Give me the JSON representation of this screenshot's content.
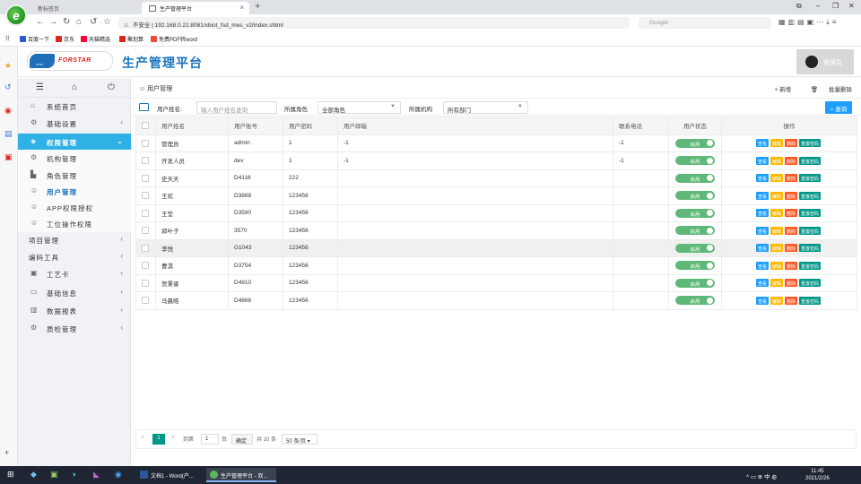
{
  "browser": {
    "tabs": [
      {
        "label": "新标签页"
      },
      {
        "label": "生产管理平台"
      }
    ],
    "url_warning": "不安全",
    "url": "192.168.0.21:8081/xbiot_fsd_mes_v2/index.shtml",
    "search_placeholder": "Google",
    "bookmarks": [
      {
        "label": "百度一下",
        "color": "#2c5bd8"
      },
      {
        "label": "京东",
        "color": "#e1251b"
      },
      {
        "label": "天猫精选",
        "color": "#ff0036"
      },
      {
        "label": "聚划算",
        "color": "#e1251b"
      },
      {
        "label": "免费PDF转word",
        "color": "#e84c3d"
      }
    ]
  },
  "header": {
    "logo_text": "FORSTAR",
    "logo_sub": "AYHC",
    "title": "生产管理平台",
    "user": "管理员"
  },
  "sidebar": {
    "items": [
      {
        "label": "系统首页",
        "icon": "⌂",
        "chev": ""
      },
      {
        "label": "基础设置",
        "icon": "⚙",
        "chev": "‹"
      },
      {
        "label": "权限管理",
        "icon": "◈",
        "chev": "⌄"
      },
      {
        "label": "机构管理",
        "icon": "⚙",
        "chev": ""
      },
      {
        "label": "角色管理",
        "icon": "▙",
        "chev": ""
      },
      {
        "label": "用户管理",
        "icon": "☺",
        "chev": ""
      },
      {
        "label": "APP权限授权",
        "icon": "☺",
        "chev": ""
      },
      {
        "label": "工位操作权限",
        "icon": "☺",
        "chev": ""
      },
      {
        "label": "项目管理",
        "icon": "",
        "chev": "‹"
      },
      {
        "label": "编码工具",
        "icon": "",
        "chev": "‹"
      },
      {
        "label": "工艺卡",
        "icon": "▣",
        "chev": "‹"
      },
      {
        "label": "基础信息",
        "icon": "▭",
        "chev": "‹"
      },
      {
        "label": "数据报表",
        "icon": "▥",
        "chev": "‹"
      },
      {
        "label": "质检管理",
        "icon": "⚙",
        "chev": "‹"
      }
    ]
  },
  "main": {
    "breadcrumb": "用户管理",
    "add_label": "+ 新增",
    "batch_delete_label": "批量删除",
    "filter": {
      "name_label": "用户姓名:",
      "name_placeholder": "输入用户姓名查询",
      "role_label": "所属角色",
      "role_value": "全部角色",
      "org_label": "所属机构",
      "org_value": "所有部门",
      "query_label": "查询"
    },
    "columns": [
      "",
      "用户姓名",
      "用户账号",
      "用户密码",
      "用户邮箱",
      "联系电话",
      "用户状态",
      "操作"
    ],
    "status_label": "启用",
    "actions": {
      "view": "查看",
      "edit": "编辑",
      "delete": "删除",
      "reset": "重置密码"
    },
    "rows": [
      {
        "name": "管理员",
        "account": "admin",
        "password": "1",
        "email": "-1",
        "phone": "-1"
      },
      {
        "name": "开发人员",
        "account": "dev",
        "password": "1",
        "email": "-1",
        "phone": "-1"
      },
      {
        "name": "史天天",
        "account": "D4116",
        "password": "222",
        "email": "",
        "phone": ""
      },
      {
        "name": "王欢",
        "account": "D3868",
        "password": "123456",
        "email": "",
        "phone": ""
      },
      {
        "name": "王莹",
        "account": "D3590",
        "password": "123456",
        "email": "",
        "phone": ""
      },
      {
        "name": "郭叶子",
        "account": "3570",
        "password": "123456",
        "email": "",
        "phone": ""
      },
      {
        "name": "李悦",
        "account": "G1043",
        "password": "123456",
        "email": "",
        "phone": ""
      },
      {
        "name": "曹淇",
        "account": "D3754",
        "password": "123456",
        "email": "",
        "phone": ""
      },
      {
        "name": "贺秉睿",
        "account": "D4910",
        "password": "123456",
        "email": "",
        "phone": ""
      },
      {
        "name": "马晨皓",
        "account": "D4866",
        "password": "123456",
        "email": "",
        "phone": ""
      }
    ],
    "pager": {
      "current": "1",
      "goto_label": "到第",
      "page_input": "1",
      "page_unit": "页",
      "confirm": "确定",
      "total": "共 10 条",
      "size": "50 条/页"
    }
  },
  "taskbar": {
    "apps": [
      {
        "label": "文档1 - Word(产...",
        "color": "#2b579a"
      },
      {
        "label": "生产管理平台 - 双...",
        "color": "#5cb85c"
      }
    ],
    "tray": "中",
    "time": "11:45",
    "date": "2021/2/26"
  }
}
